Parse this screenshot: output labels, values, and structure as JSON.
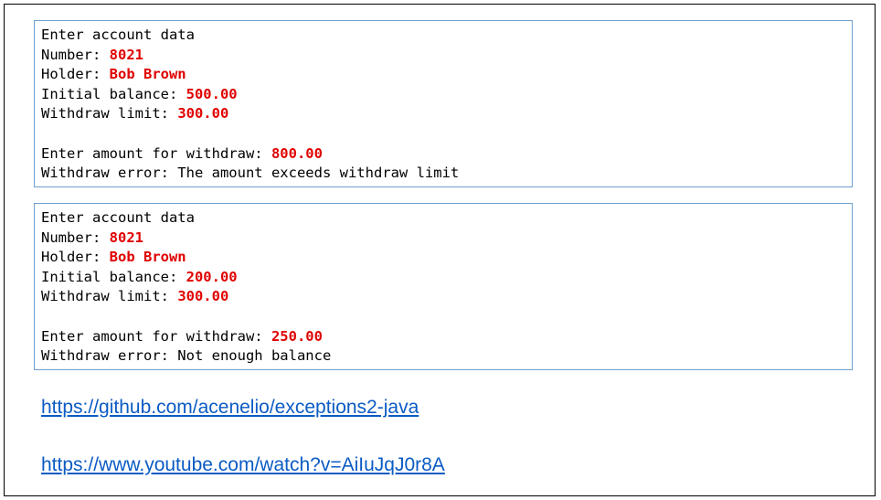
{
  "consoles": [
    {
      "header": "Enter account data",
      "number_label": "Number: ",
      "number_value": "8021",
      "holder_label": "Holder: ",
      "holder_value": "Bob Brown",
      "balance_label": "Initial balance: ",
      "balance_value": "500.00",
      "limit_label": "Withdraw limit: ",
      "limit_value": "300.00",
      "amount_label": "Enter amount for withdraw: ",
      "amount_value": "800.00",
      "error_text": "Withdraw error: The amount exceeds withdraw limit"
    },
    {
      "header": "Enter account data",
      "number_label": "Number: ",
      "number_value": "8021",
      "holder_label": "Holder: ",
      "holder_value": "Bob Brown",
      "balance_label": "Initial balance: ",
      "balance_value": "200.00",
      "limit_label": "Withdraw limit: ",
      "limit_value": "300.00",
      "amount_label": "Enter amount for withdraw: ",
      "amount_value": "250.00",
      "error_text": "Withdraw error: Not enough balance"
    }
  ],
  "links": [
    {
      "text": "https://github.com/acenelio/exceptions2-java"
    },
    {
      "text": "https://www.youtube.com/watch?v=AiIuJqJ0r8A"
    }
  ],
  "colors": {
    "input_value": "#e00000",
    "console_border": "#6fa0d0",
    "link": "#0b5bc4"
  }
}
